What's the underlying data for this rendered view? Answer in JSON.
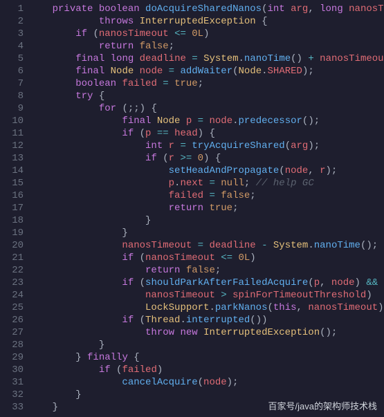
{
  "lineCount": 33,
  "code": {
    "l1": [
      [
        "kw",
        "private "
      ],
      [
        "kw",
        "boolean "
      ],
      [
        "fn",
        "doAcquireSharedNanos"
      ],
      [
        "pn",
        "("
      ],
      [
        "kw",
        "int "
      ],
      [
        "id",
        "arg"
      ],
      [
        "pn",
        ", "
      ],
      [
        "kw",
        "long "
      ],
      [
        "id",
        "nanosTimeout"
      ],
      [
        "pn",
        ")"
      ]
    ],
    "l2": [
      [
        "kw",
        "throws "
      ],
      [
        "type",
        "InterruptedException"
      ],
      [
        "pn",
        " {"
      ]
    ],
    "l3": [
      [
        "kw",
        "if "
      ],
      [
        "pn",
        "("
      ],
      [
        "id",
        "nanosTimeout"
      ],
      [
        "op",
        " <= "
      ],
      [
        "lit",
        "0L"
      ],
      [
        "pn",
        ")"
      ]
    ],
    "l4": [
      [
        "kw",
        "return "
      ],
      [
        "lit",
        "false"
      ],
      [
        "pn",
        ";"
      ]
    ],
    "l5": [
      [
        "kw",
        "final "
      ],
      [
        "kw",
        "long "
      ],
      [
        "id",
        "deadline"
      ],
      [
        "op",
        " = "
      ],
      [
        "type",
        "System"
      ],
      [
        "pn",
        "."
      ],
      [
        "fn",
        "nanoTime"
      ],
      [
        "pn",
        "() "
      ],
      [
        "op",
        "+"
      ],
      [
        "pn",
        " "
      ],
      [
        "id",
        "nanosTimeout"
      ],
      [
        "pn",
        ";"
      ]
    ],
    "l6": [
      [
        "kw",
        "final "
      ],
      [
        "type",
        "Node "
      ],
      [
        "id",
        "node"
      ],
      [
        "op",
        " = "
      ],
      [
        "fn",
        "addWaiter"
      ],
      [
        "pn",
        "("
      ],
      [
        "type",
        "Node"
      ],
      [
        "pn",
        "."
      ],
      [
        "prop",
        "SHARED"
      ],
      [
        "pn",
        ");"
      ]
    ],
    "l7": [
      [
        "kw",
        "boolean "
      ],
      [
        "id",
        "failed"
      ],
      [
        "op",
        " = "
      ],
      [
        "lit",
        "true"
      ],
      [
        "pn",
        ";"
      ]
    ],
    "l8": [
      [
        "kw",
        "try "
      ],
      [
        "pn",
        "{"
      ]
    ],
    "l9": [
      [
        "kw",
        "for "
      ],
      [
        "pn",
        "(;;) {"
      ]
    ],
    "l10": [
      [
        "kw",
        "final "
      ],
      [
        "type",
        "Node "
      ],
      [
        "id",
        "p"
      ],
      [
        "op",
        " = "
      ],
      [
        "id",
        "node"
      ],
      [
        "pn",
        "."
      ],
      [
        "fn",
        "predecessor"
      ],
      [
        "pn",
        "();"
      ]
    ],
    "l11": [
      [
        "kw",
        "if "
      ],
      [
        "pn",
        "("
      ],
      [
        "id",
        "p"
      ],
      [
        "op",
        " == "
      ],
      [
        "id",
        "head"
      ],
      [
        "pn",
        ") {"
      ]
    ],
    "l12": [
      [
        "kw",
        "int "
      ],
      [
        "id",
        "r"
      ],
      [
        "op",
        " = "
      ],
      [
        "fn",
        "tryAcquireShared"
      ],
      [
        "pn",
        "("
      ],
      [
        "id",
        "arg"
      ],
      [
        "pn",
        ");"
      ]
    ],
    "l13": [
      [
        "kw",
        "if "
      ],
      [
        "pn",
        "("
      ],
      [
        "id",
        "r"
      ],
      [
        "op",
        " >= "
      ],
      [
        "num",
        "0"
      ],
      [
        "pn",
        ") {"
      ]
    ],
    "l14": [
      [
        "fn",
        "setHeadAndPropagate"
      ],
      [
        "pn",
        "("
      ],
      [
        "id",
        "node"
      ],
      [
        "pn",
        ", "
      ],
      [
        "id",
        "r"
      ],
      [
        "pn",
        ");"
      ]
    ],
    "l15": [
      [
        "id",
        "p"
      ],
      [
        "pn",
        "."
      ],
      [
        "prop",
        "next"
      ],
      [
        "op",
        " = "
      ],
      [
        "lit",
        "null"
      ],
      [
        "pn",
        "; "
      ],
      [
        "cm",
        "// help GC"
      ]
    ],
    "l16": [
      [
        "id",
        "failed"
      ],
      [
        "op",
        " = "
      ],
      [
        "lit",
        "false"
      ],
      [
        "pn",
        ";"
      ]
    ],
    "l17": [
      [
        "kw",
        "return "
      ],
      [
        "lit",
        "true"
      ],
      [
        "pn",
        ";"
      ]
    ],
    "l18": [
      [
        "pn",
        "}"
      ]
    ],
    "l19": [
      [
        "pn",
        "}"
      ]
    ],
    "l20": [
      [
        "id",
        "nanosTimeout"
      ],
      [
        "op",
        " = "
      ],
      [
        "id",
        "deadline"
      ],
      [
        "op",
        " - "
      ],
      [
        "type",
        "System"
      ],
      [
        "pn",
        "."
      ],
      [
        "fn",
        "nanoTime"
      ],
      [
        "pn",
        "();"
      ]
    ],
    "l21": [
      [
        "kw",
        "if "
      ],
      [
        "pn",
        "("
      ],
      [
        "id",
        "nanosTimeout"
      ],
      [
        "op",
        " <= "
      ],
      [
        "lit",
        "0L"
      ],
      [
        "pn",
        ")"
      ]
    ],
    "l22": [
      [
        "kw",
        "return "
      ],
      [
        "lit",
        "false"
      ],
      [
        "pn",
        ";"
      ]
    ],
    "l23": [
      [
        "kw",
        "if "
      ],
      [
        "pn",
        "("
      ],
      [
        "fn",
        "shouldParkAfterFailedAcquire"
      ],
      [
        "pn",
        "("
      ],
      [
        "id",
        "p"
      ],
      [
        "pn",
        ", "
      ],
      [
        "id",
        "node"
      ],
      [
        "pn",
        ") "
      ],
      [
        "op",
        "&&"
      ]
    ],
    "l24": [
      [
        "id",
        "nanosTimeout"
      ],
      [
        "op",
        " > "
      ],
      [
        "id",
        "spinForTimeoutThreshold"
      ],
      [
        "pn",
        ")"
      ]
    ],
    "l25": [
      [
        "type",
        "LockSupport"
      ],
      [
        "pn",
        "."
      ],
      [
        "fn",
        "parkNanos"
      ],
      [
        "pn",
        "("
      ],
      [
        "this",
        "this"
      ],
      [
        "pn",
        ", "
      ],
      [
        "id",
        "nanosTimeout"
      ],
      [
        "pn",
        ");"
      ]
    ],
    "l26": [
      [
        "kw",
        "if "
      ],
      [
        "pn",
        "("
      ],
      [
        "type",
        "Thread"
      ],
      [
        "pn",
        "."
      ],
      [
        "fn",
        "interrupted"
      ],
      [
        "pn",
        "())"
      ]
    ],
    "l27": [
      [
        "kw",
        "throw "
      ],
      [
        "kw",
        "new "
      ],
      [
        "type",
        "InterruptedException"
      ],
      [
        "pn",
        "();"
      ]
    ],
    "l28": [
      [
        "pn",
        "}"
      ]
    ],
    "l29": [
      [
        "pn",
        "} "
      ],
      [
        "kw",
        "finally "
      ],
      [
        "pn",
        "{"
      ]
    ],
    "l30": [
      [
        "kw",
        "if "
      ],
      [
        "pn",
        "("
      ],
      [
        "id",
        "failed"
      ],
      [
        "pn",
        ")"
      ]
    ],
    "l31": [
      [
        "fn",
        "cancelAcquire"
      ],
      [
        "pn",
        "("
      ],
      [
        "id",
        "node"
      ],
      [
        "pn",
        ");"
      ]
    ],
    "l32": [
      [
        "pn",
        "}"
      ]
    ],
    "l33": [
      [
        "pn",
        "}"
      ]
    ]
  },
  "indents": {
    "l1": "    ",
    "l2": "            ",
    "l3": "        ",
    "l4": "            ",
    "l5": "        ",
    "l6": "        ",
    "l7": "        ",
    "l8": "        ",
    "l9": "            ",
    "l10": "                ",
    "l11": "                ",
    "l12": "                    ",
    "l13": "                    ",
    "l14": "                        ",
    "l15": "                        ",
    "l16": "                        ",
    "l17": "                        ",
    "l18": "                    ",
    "l19": "                ",
    "l20": "                ",
    "l21": "                ",
    "l22": "                    ",
    "l23": "                ",
    "l24": "                    ",
    "l25": "                    ",
    "l26": "                ",
    "l27": "                    ",
    "l28": "            ",
    "l29": "        ",
    "l30": "            ",
    "l31": "                ",
    "l32": "        ",
    "l33": "    "
  },
  "footer": "百家号/java的架构师技术栈"
}
